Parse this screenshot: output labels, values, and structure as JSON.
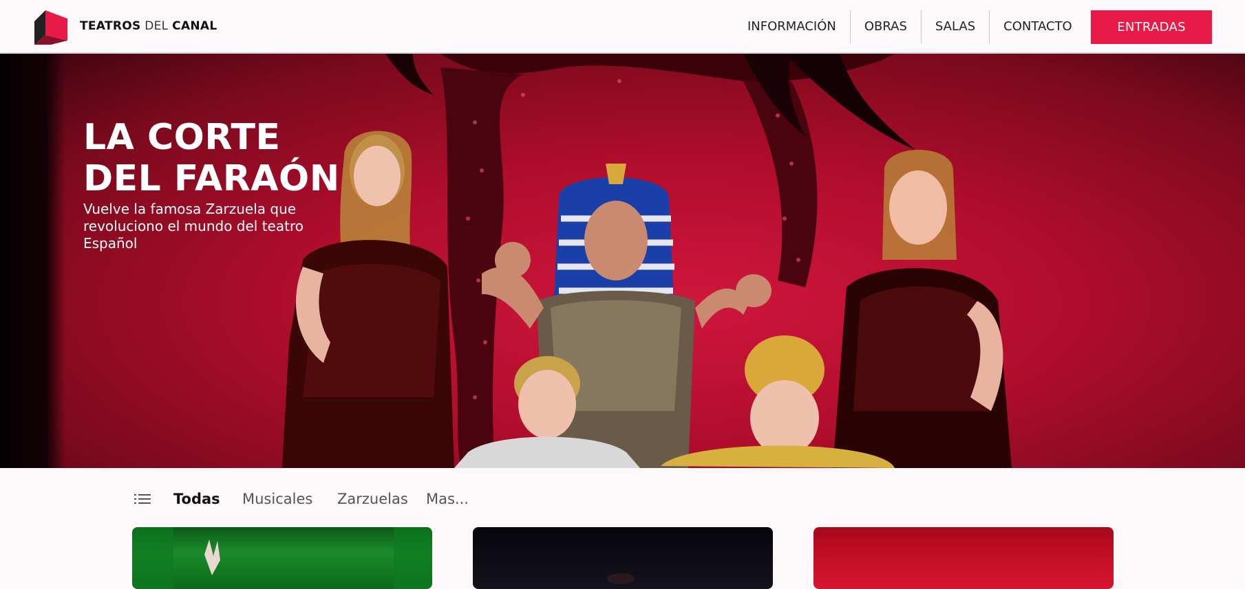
{
  "header": {
    "brand": {
      "part1": "TEATROS",
      "part2": "DEL",
      "part3": "CANAL"
    },
    "nav": [
      {
        "label": "INFORMACIÓN"
      },
      {
        "label": "OBRAS"
      },
      {
        "label": "SALAS"
      },
      {
        "label": "CONTACTO"
      }
    ],
    "cta_label": "ENTRADAS"
  },
  "hero": {
    "title_line1": "LA CORTE",
    "title_line2": "DEL FARAÓN",
    "subtitle": "Vuelve la famosa Zarzuela que revoluciono el mundo del teatro Español"
  },
  "filters": {
    "icon": "list-icon",
    "items": [
      {
        "label": "Todas",
        "active": true
      },
      {
        "label": "Musicales",
        "active": false
      },
      {
        "label": "Zarzuelas",
        "active": false
      },
      {
        "label": "Mas...",
        "active": false
      }
    ]
  },
  "colors": {
    "accent": "#e81b48",
    "background": "#fdf8f9",
    "hero_red": "#c8102a"
  }
}
